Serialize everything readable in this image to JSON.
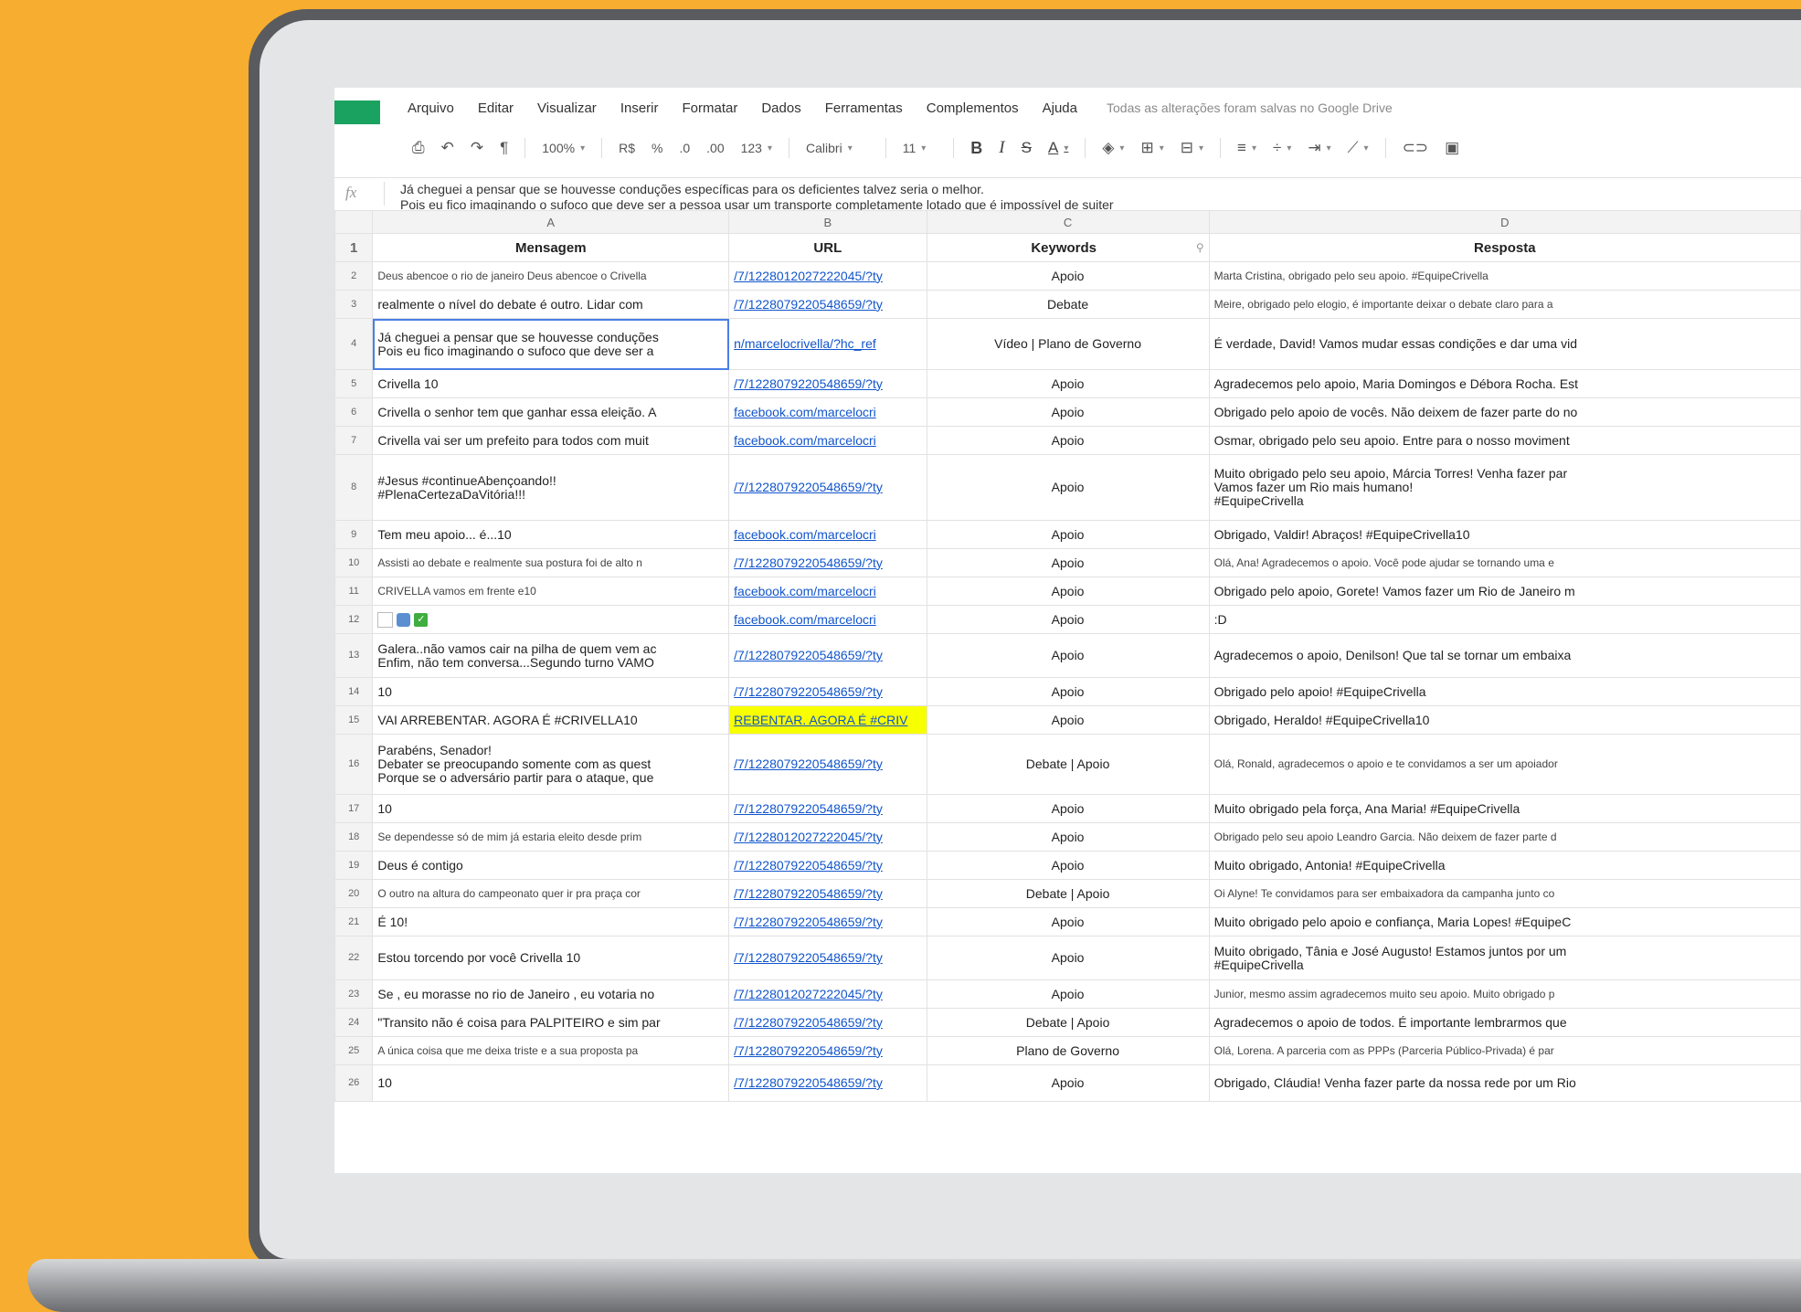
{
  "menu": {
    "items": [
      "Arquivo",
      "Editar",
      "Visualizar",
      "Inserir",
      "Formatar",
      "Dados",
      "Ferramentas",
      "Complementos",
      "Ajuda"
    ],
    "save_status": "Todas as alterações foram salvas no Google Drive"
  },
  "toolbar": {
    "zoom": "100%",
    "currency": "R$",
    "percent": "%",
    "decrease_decimal": ".0",
    "increase_decimal": ".00",
    "more_formats": "123",
    "font": "Calibri",
    "font_size": "11"
  },
  "formula_bar": {
    "fx": "fx",
    "line1": "Já cheguei a pensar que se houvesse conduções específicas para os deficientes talvez seria o melhor.",
    "line2": "Pois eu fico imaginando o sufoco que deve ser a pessoa usar um transporte completamente lotado que é impossível de suiter"
  },
  "columns": [
    "A",
    "B",
    "C",
    "D"
  ],
  "header": {
    "mensagem": "Mensagem",
    "url": "URL",
    "keywords": "Keywords",
    "resposta": "Resposta"
  },
  "rows": [
    {
      "n": "2",
      "msg": "Deus abencoe o rio de janeiro Deus abencoe o Crivella",
      "url": "/7/1228012027222045/?ty",
      "kw": "Apoio",
      "resp": "Marta Cristina, obrigado pelo seu apoio. #EquipeCrivella"
    },
    {
      "n": "3",
      "msg": "realmente o nível do debate é outro. Lidar com",
      "url": "/7/1228079220548659/?ty",
      "kw": "Debate",
      "resp": "Meire, obrigado pelo elogio, é importante deixar o debate claro para a"
    },
    {
      "n": "4",
      "msg": "Já cheguei a pensar que se houvesse conduções",
      "msg2": "Pois eu fico imaginando o sufoco que deve ser a",
      "url": "n/marcelocrivella/?hc_ref",
      "kw": "Vídeo | Plano de Governo",
      "resp": "É verdade, David! Vamos mudar essas condições e dar uma vid"
    },
    {
      "n": "5",
      "msg": "Crivella 10",
      "url": "/7/1228079220548659/?ty",
      "kw": "Apoio",
      "resp": "Agradecemos pelo apoio, Maria Domingos e Débora Rocha. Est"
    },
    {
      "n": "6",
      "msg": "Crivella o senhor tem que ganhar essa eleição. A",
      "url": "facebook.com/marcelocri",
      "kw": "Apoio",
      "resp": "Obrigado pelo apoio de vocês. Não deixem de fazer parte do no"
    },
    {
      "n": "7",
      "msg": "Crivella vai ser um prefeito para todos com muit",
      "url": "facebook.com/marcelocri",
      "kw": "Apoio",
      "resp": "Osmar, obrigado pelo seu apoio. Entre para o nosso moviment"
    },
    {
      "n": "8",
      "msg": "#Jesus #continueAbençoando!!",
      "msg2": "#PlenaCertezaDaVitória!!!",
      "url": "/7/1228079220548659/?ty",
      "kw": "Apoio",
      "resp": "Muito obrigado pelo seu apoio, Márcia Torres! Venha fazer par",
      "resp2": "Vamos fazer um Rio mais humano!",
      "resp3": "#EquipeCrivella"
    },
    {
      "n": "9",
      "msg": "Tem meu apoio... é...10",
      "url": "facebook.com/marcelocri",
      "kw": "Apoio",
      "resp": "Obrigado, Valdir! Abraços! #EquipeCrivella10"
    },
    {
      "n": "10",
      "msg": "Assisti ao debate e realmente sua postura foi de alto n",
      "url": "/7/1228079220548659/?ty",
      "kw": "Apoio",
      "resp": "Olá, Ana! Agradecemos o apoio. Você pode ajudar se tornando uma e"
    },
    {
      "n": "11",
      "msg": "CRIVELLA vamos em frente e10",
      "url": "facebook.com/marcelocri",
      "kw": "Apoio",
      "resp": "Obrigado pelo apoio, Gorete! Vamos fazer um Rio de Janeiro m"
    },
    {
      "n": "12",
      "msg": "",
      "url": "facebook.com/marcelocri",
      "kw": "Apoio",
      "resp": ":D"
    },
    {
      "n": "13",
      "msg": "Galera..não vamos cair na pilha de quem vem ac",
      "msg2": "Enfim, não tem conversa...Segundo turno VAMO",
      "url": "/7/1228079220548659/?ty",
      "kw": "Apoio",
      "resp": "Agradecemos o apoio, Denilson! Que tal se tornar um embaixa"
    },
    {
      "n": "14",
      "msg": "10",
      "url": "/7/1228079220548659/?ty",
      "kw": "Apoio",
      "resp": "Obrigado pelo apoio! #EquipeCrivella"
    },
    {
      "n": "15",
      "msg": "VAI ARREBENTAR. AGORA É #CRIVELLA10",
      "url": "REBENTAR. AGORA É #CRIV",
      "kw": "Apoio",
      "resp": "Obrigado, Heraldo! #EquipeCrivella10"
    },
    {
      "n": "16",
      "msg": "Parabéns, Senador!",
      "msg2": "Debater se preocupando somente com as quest",
      "msg3": "Porque se o adversário partir para o ataque, que",
      "url": "/7/1228079220548659/?ty",
      "kw": "Debate | Apoio",
      "resp": "Olá, Ronald, agradecemos o apoio e te convidamos a ser um apoiador"
    },
    {
      "n": "17",
      "msg": "10",
      "url": "/7/1228079220548659/?ty",
      "kw": "Apoio",
      "resp": "Muito obrigado pela força, Ana Maria! #EquipeCrivella"
    },
    {
      "n": "18",
      "msg": "Se dependesse só de mim já estaria eleito desde prim",
      "url": "/7/1228012027222045/?ty",
      "kw": "Apoio",
      "resp": "Obrigado pelo seu apoio Leandro Garcia. Não deixem de fazer parte d"
    },
    {
      "n": "19",
      "msg": "Deus é contigo",
      "url": "/7/1228079220548659/?ty",
      "kw": "Apoio",
      "resp": "Muito obrigado, Antonia! #EquipeCrivella"
    },
    {
      "n": "20",
      "msg": "O outro na altura do campeonato quer ir pra praça cor",
      "url": "/7/1228079220548659/?ty",
      "kw": "Debate | Apoio",
      "resp": "Oi Alyne! Te convidamos para ser embaixadora da campanha junto co"
    },
    {
      "n": "21",
      "msg": "É 10!",
      "url": "/7/1228079220548659/?ty",
      "kw": "Apoio",
      "resp": "Muito obrigado pelo apoio e confiança, Maria Lopes! #EquipeC"
    },
    {
      "n": "22",
      "msg": "Estou torcendo por você Crivella 10",
      "url": "/7/1228079220548659/?ty",
      "kw": "Apoio",
      "resp": "Muito obrigado, Tânia e José Augusto! Estamos juntos por um",
      "resp2": "#EquipeCrivella"
    },
    {
      "n": "23",
      "msg": "Se , eu morasse no rio de Janeiro , eu votaria no",
      "url": "/7/1228012027222045/?ty",
      "kw": "Apoio",
      "resp": "Junior, mesmo assim agradecemos muito seu apoio. Muito obrigado p"
    },
    {
      "n": "24",
      "msg": "\"Transito não é coisa para PALPITEIRO e sim par",
      "url": "/7/1228079220548659/?ty",
      "kw": "Debate | Apoio",
      "resp": "Agradecemos o apoio de todos. É importante lembrarmos que"
    },
    {
      "n": "25",
      "msg": "A única coisa que me deixa triste e a sua proposta pa",
      "url": "/7/1228079220548659/?ty",
      "kw": "Plano de Governo",
      "resp": "Olá, Lorena. A parceria com as PPPs (Parceria Público-Privada) é par"
    },
    {
      "n": "26",
      "msg": "10",
      "url": "/7/1228079220548659/?ty",
      "kw": "Apoio",
      "resp": "Obrigado, Cláudia! Venha fazer parte da nossa rede por um Rio"
    }
  ]
}
